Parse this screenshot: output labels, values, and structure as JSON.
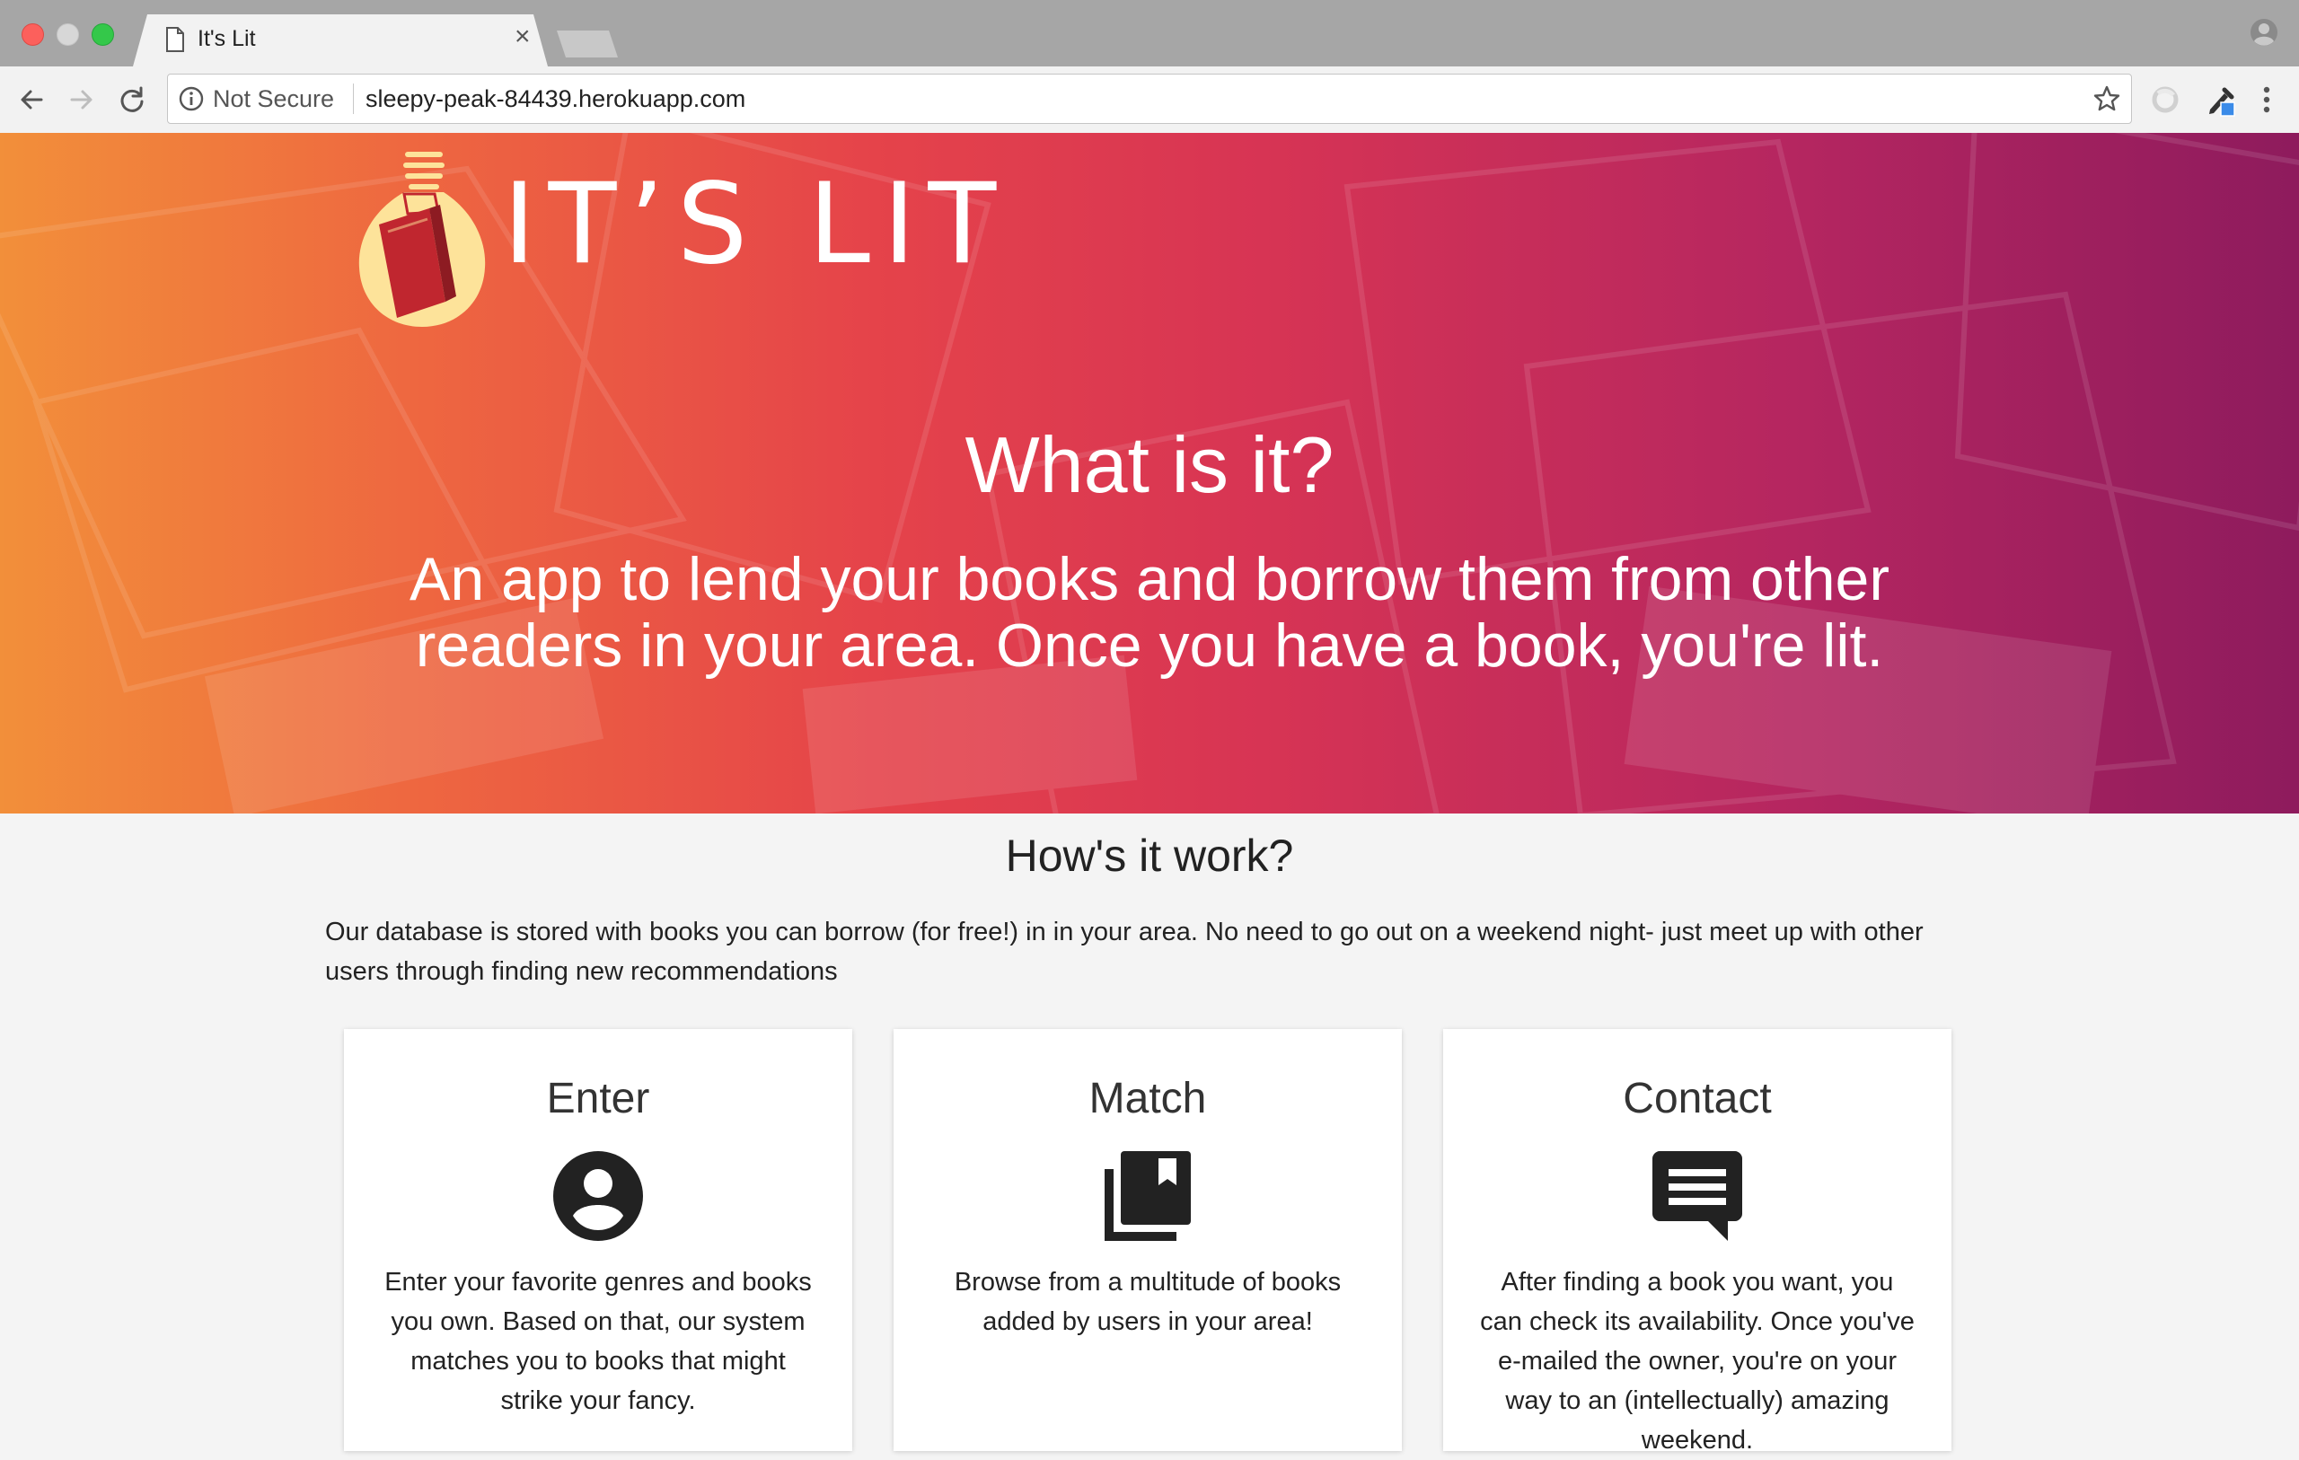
{
  "browser": {
    "tab_title": "It's Lit",
    "tab_close": "×",
    "security_label": "Not Secure",
    "url": "sleepy-peak-84439.herokuapp.com"
  },
  "hero": {
    "logo_text": "IT’S LIT",
    "title": "What is it?",
    "subtitle": "An app to lend your books and borrow them from other readers in your area. Once you have a book, you're lit."
  },
  "how": {
    "title": "How's it work?",
    "description": "Our database is stored with books you can borrow (for free!) in in your area. No need to go out on a weekend night- just meet up with other users through finding new recommendations"
  },
  "cards": [
    {
      "title": "Enter",
      "icon": "account-circle-icon",
      "text": "Enter your favorite genres and books you own. Based on that, our system matches you to books that might strike your fancy."
    },
    {
      "title": "Match",
      "icon": "library-books-icon",
      "text": "Browse from a multitude of books added by users in your area!"
    },
    {
      "title": "Contact",
      "icon": "chat-message-icon",
      "text": "After finding a book you want, you can check its availability. Once you've e-mailed the owner, you're on your way to an (intellectually) amazing weekend."
    }
  ],
  "colors": {
    "hero_gradient_start": "#f28f3a",
    "hero_gradient_mid": "#e5434a",
    "hero_gradient_end": "#8e1b5d",
    "page_background": "#f4f4f4",
    "card_background": "#ffffff",
    "logo_bulb": "#fde39a",
    "logo_book": "#c0262f"
  }
}
